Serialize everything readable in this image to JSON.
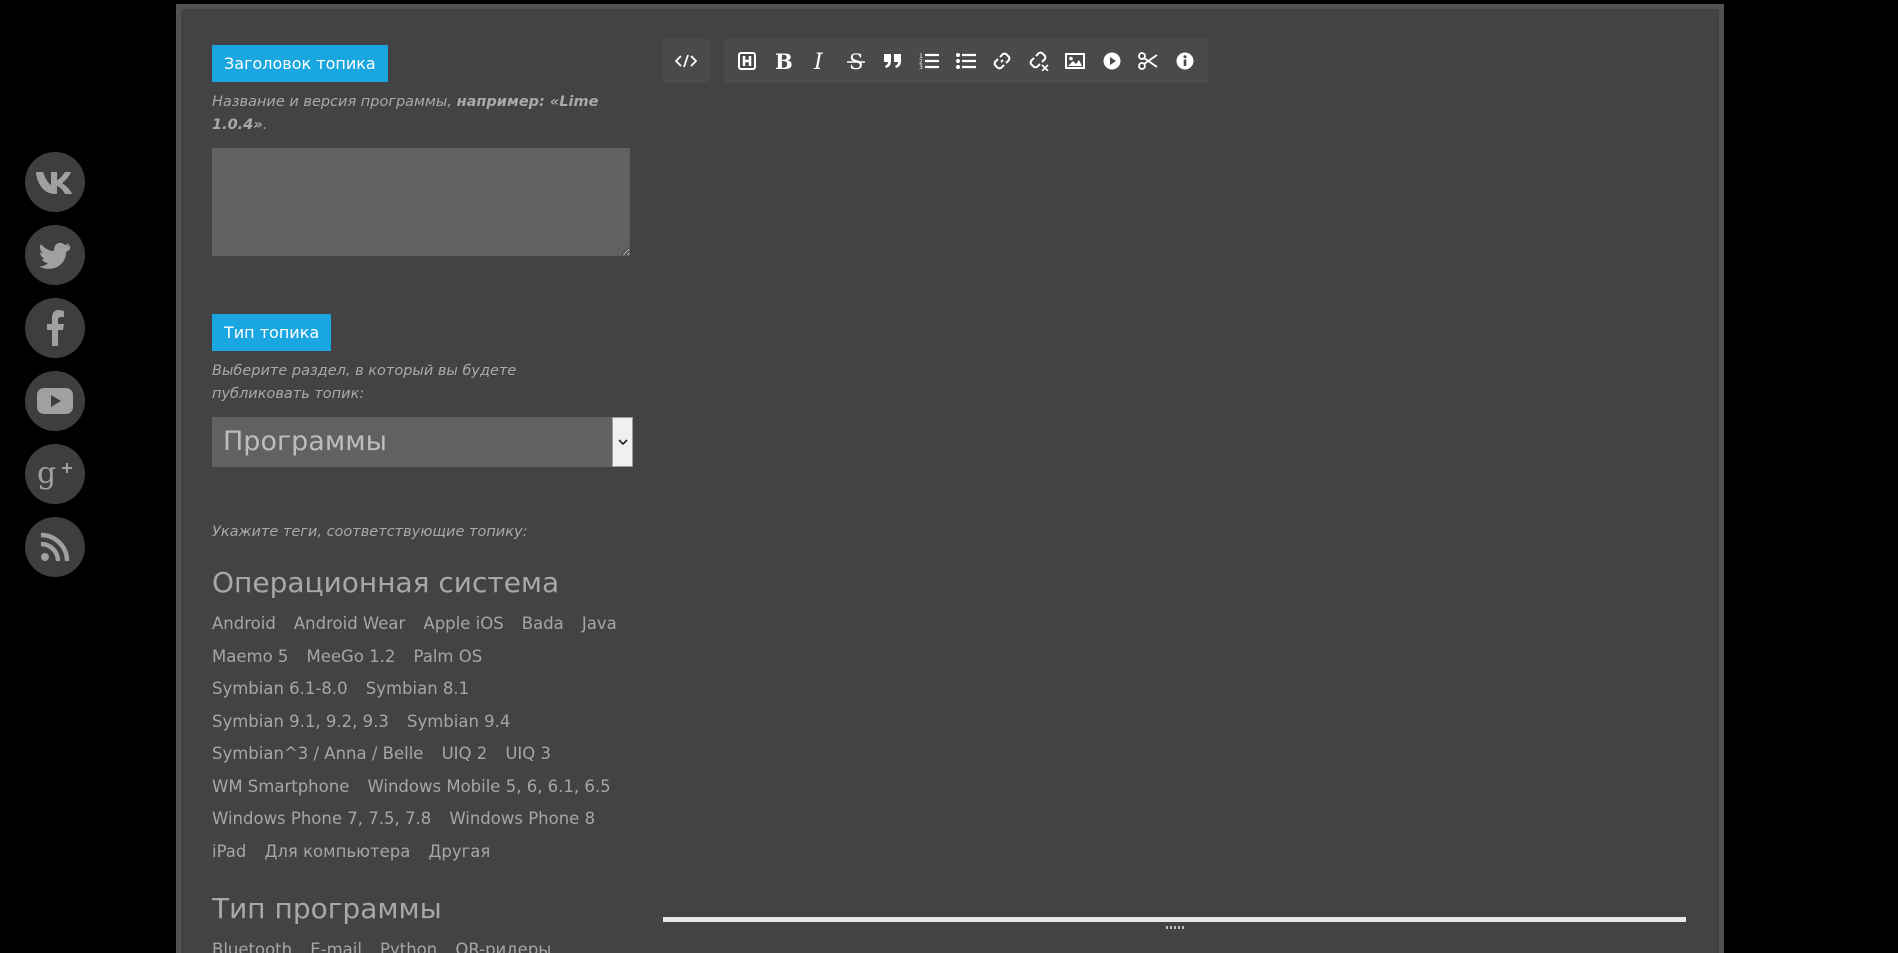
{
  "social": [
    {
      "name": "vk-icon"
    },
    {
      "name": "twitter-icon"
    },
    {
      "name": "facebook-icon"
    },
    {
      "name": "youtube-icon"
    },
    {
      "name": "google-plus-icon"
    },
    {
      "name": "rss-icon"
    }
  ],
  "form": {
    "title_label": "Заголовок топика",
    "title_hint_prefix": "Название и версия программы, ",
    "title_hint_bold": "например: «Lime 1.0.4»",
    "title_hint_suffix": ".",
    "title_value": "",
    "type_label": "Тип топика",
    "type_hint": "Выберите раздел, в который вы будете публиковать топик:",
    "type_selected": "Программы",
    "tags_hint": "Укажите теги, соответствующие топику:"
  },
  "tag_categories": [
    {
      "title": "Операционная система",
      "tags": [
        "Android",
        "Android Wear",
        "Apple iOS",
        "Bada",
        "Java",
        "Maemo 5",
        "MeeGo 1.2",
        "Palm OS",
        "Symbian 6.1-8.0",
        "Symbian 8.1",
        "Symbian 9.1, 9.2, 9.3",
        "Symbian 9.4",
        "Symbian^3 / Anna / Belle",
        "UIQ 2",
        "UIQ 3",
        "WM Smartphone",
        "Windows Mobile 5, 6, 6.1, 6.5",
        "Windows Phone 7, 7.5, 7.8",
        "Windows Phone 8",
        "iPad",
        "Для компьютера",
        "Другая"
      ]
    },
    {
      "title": "Тип программы",
      "tags": [
        "Bluetooth",
        "E-mail",
        "Python",
        "QR-ридеры"
      ]
    }
  ],
  "toolbar": {
    "source_icon": "code-icon",
    "buttons": [
      "heading-icon",
      "bold-icon",
      "italic-icon",
      "strike-icon",
      "quote-icon",
      "ordered-list-icon",
      "unordered-list-icon",
      "link-icon",
      "unlink-icon",
      "image-icon",
      "video-icon",
      "cut-icon",
      "info-icon"
    ]
  },
  "colors": {
    "accent": "#1aa6e0",
    "panel": "#434343",
    "input": "#616161"
  }
}
